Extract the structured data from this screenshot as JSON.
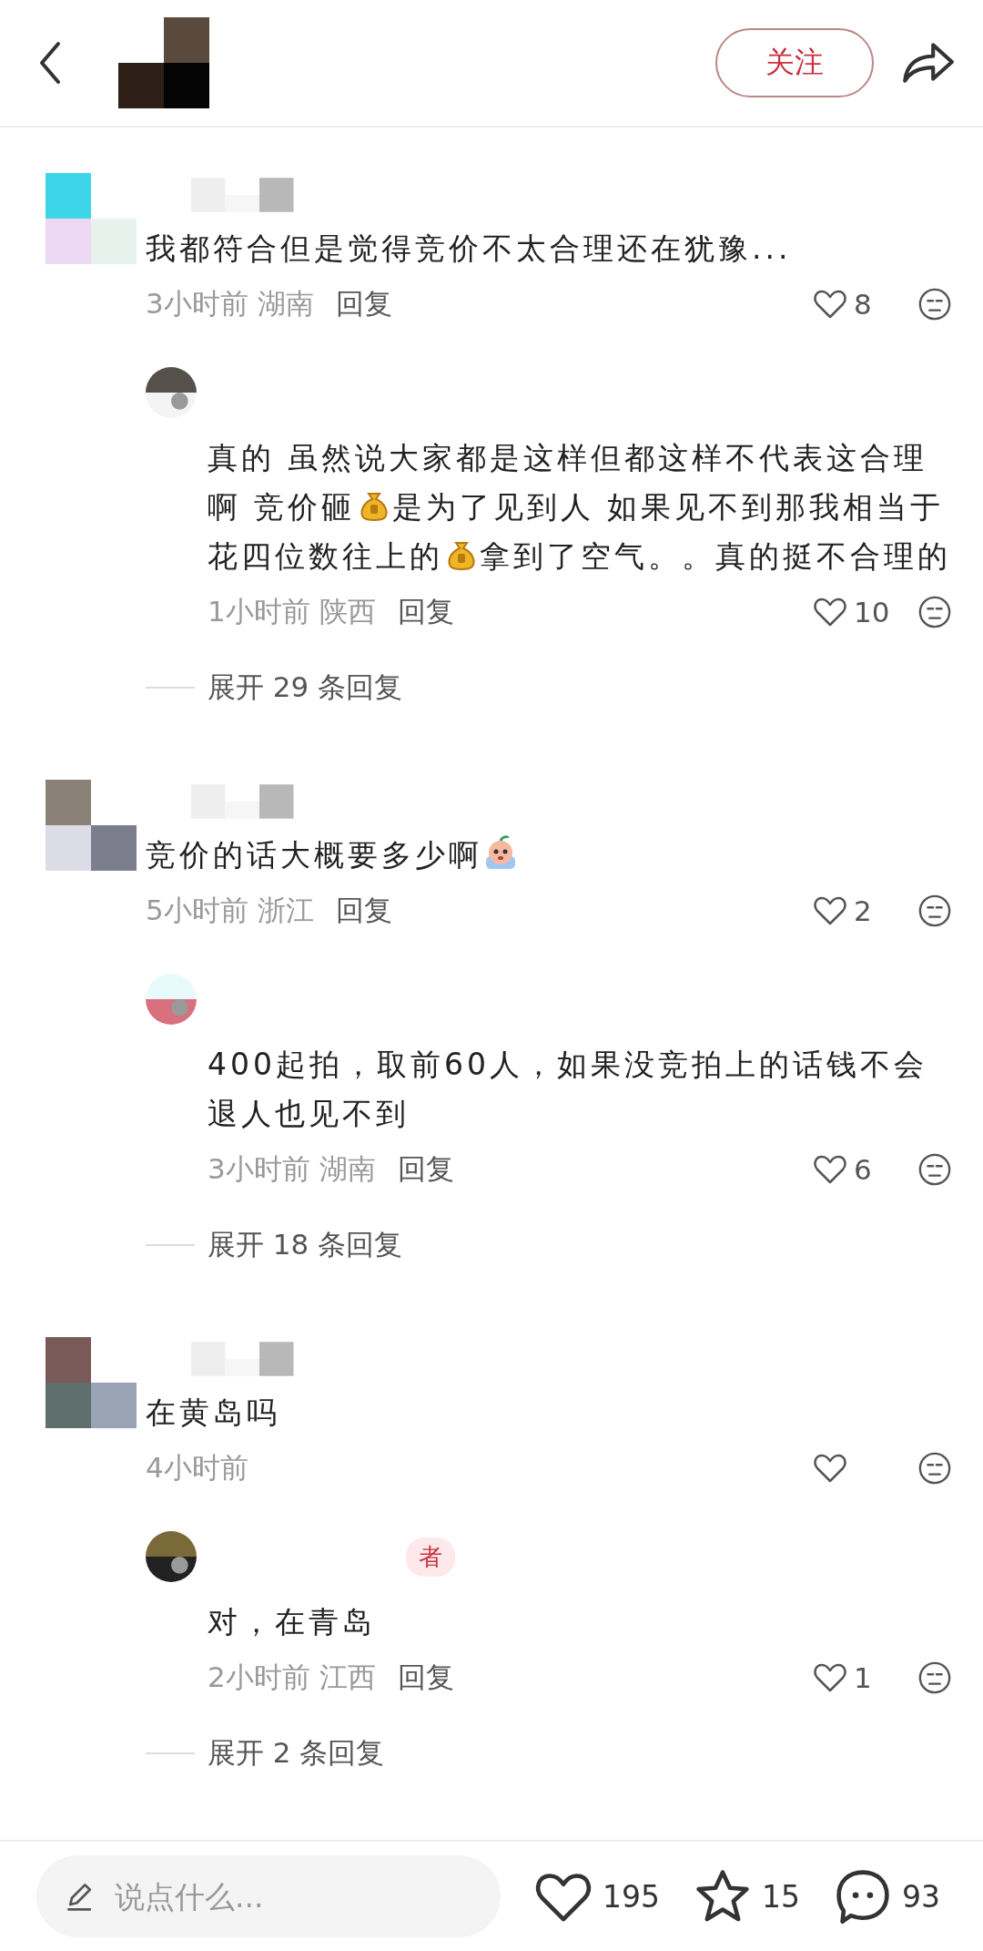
{
  "header": {
    "follow_button": "关注"
  },
  "comments": [
    {
      "segments": [
        {
          "kind": "text",
          "text": "我都符合但是觉得竞价不太合理还在犹豫..."
        }
      ],
      "time": "3小时前",
      "location": "湖南",
      "reply_label": "回复",
      "likes": "8",
      "replies": [
        {
          "segments": [
            {
              "kind": "text",
              "text": "真的 虽然说大家都是这样但都这样不代表这合理啊 竞价砸"
            },
            {
              "kind": "money"
            },
            {
              "kind": "text",
              "text": "是为了见到人 如果见不到那我相当于花四位数往上的"
            },
            {
              "kind": "money"
            },
            {
              "kind": "text",
              "text": "拿到了空气。。真的挺不合理的"
            }
          ],
          "time": "1小时前",
          "location": "陕西",
          "reply_label": "回复",
          "likes": "10"
        }
      ],
      "expand": "展开 29 条回复"
    },
    {
      "segments": [
        {
          "kind": "text",
          "text": "竞价的话大概要多少啊"
        },
        {
          "kind": "cry"
        }
      ],
      "time": "5小时前",
      "location": "浙江",
      "reply_label": "回复",
      "likes": "2",
      "replies": [
        {
          "segments": [
            {
              "kind": "text",
              "text": "400起拍，取前60人，如果没竞拍上的话钱不会退人也见不到"
            }
          ],
          "time": "3小时前",
          "location": "湖南",
          "reply_label": "回复",
          "likes": "6"
        }
      ],
      "expand": "展开 18 条回复"
    },
    {
      "segments": [
        {
          "kind": "text",
          "text": "在黄岛吗"
        }
      ],
      "time": "4小时前",
      "replies": [
        {
          "badge": "者",
          "segments": [
            {
              "kind": "text",
              "text": "对，在青岛"
            }
          ],
          "time": "2小时前",
          "location": "江西",
          "reply_label": "回复",
          "likes": "1"
        }
      ],
      "expand": "展开 2 条回复"
    }
  ],
  "input": {
    "placeholder": "说点什么..."
  },
  "stats": {
    "likes": "195",
    "favorites": "15",
    "comments": "93"
  }
}
